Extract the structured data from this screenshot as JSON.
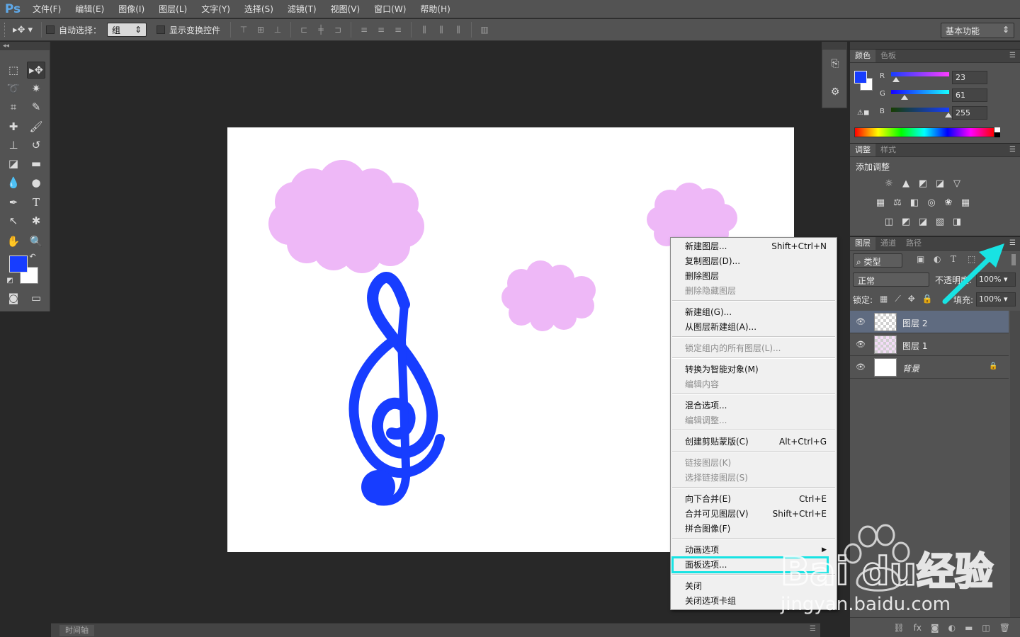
{
  "app": {
    "logo": "Ps"
  },
  "menubar": [
    "文件(F)",
    "编辑(E)",
    "图像(I)",
    "图层(L)",
    "文字(Y)",
    "选择(S)",
    "滤镜(T)",
    "视图(V)",
    "窗口(W)",
    "帮助(H)"
  ],
  "options": {
    "auto_select_label": "自动选择：",
    "auto_select_value": "组",
    "show_transform_label": "显示变换控件",
    "workspace": "基本功能"
  },
  "color_panel": {
    "tabs": [
      "颜色",
      "色板"
    ],
    "r_label": "R",
    "g_label": "G",
    "b_label": "B",
    "r_value": "23",
    "g_value": "61",
    "b_value": "255",
    "foreground_color": "#173dff"
  },
  "adjust_panel": {
    "tabs": [
      "调整",
      "样式"
    ],
    "title": "添加调整"
  },
  "layers_panel": {
    "tabs": [
      "图层",
      "通道",
      "路径"
    ],
    "filter_kind": "类型",
    "blend_mode": "正常",
    "opacity_label": "不透明度:",
    "opacity_value": "100%",
    "lock_label": "锁定:",
    "fill_label": "填充:",
    "fill_value": "100%",
    "layers": [
      {
        "name": "图层 2",
        "selected": true
      },
      {
        "name": "图层 1",
        "selected": false
      },
      {
        "name": "背景",
        "selected": false,
        "locked": true
      }
    ]
  },
  "context_menu": {
    "items": [
      {
        "label": "新建图层...",
        "shortcut": "Shift+Ctrl+N",
        "disabled": false
      },
      {
        "label": "复制图层(D)...",
        "shortcut": "",
        "disabled": false
      },
      {
        "label": "删除图层",
        "shortcut": "",
        "disabled": false
      },
      {
        "label": "删除隐藏图层",
        "shortcut": "",
        "disabled": true
      },
      {
        "label": "新建组(G)...",
        "shortcut": "",
        "disabled": false
      },
      {
        "label": "从图层新建组(A)...",
        "shortcut": "",
        "disabled": false
      },
      {
        "label": "锁定组内的所有图层(L)...",
        "shortcut": "",
        "disabled": true
      },
      {
        "label": "转换为智能对象(M)",
        "shortcut": "",
        "disabled": false
      },
      {
        "label": "编辑内容",
        "shortcut": "",
        "disabled": true
      },
      {
        "label": "混合选项...",
        "shortcut": "",
        "disabled": false
      },
      {
        "label": "编辑调整...",
        "shortcut": "",
        "disabled": true
      },
      {
        "label": "创建剪贴蒙版(C)",
        "shortcut": "Alt+Ctrl+G",
        "disabled": false
      },
      {
        "label": "链接图层(K)",
        "shortcut": "",
        "disabled": true
      },
      {
        "label": "选择链接图层(S)",
        "shortcut": "",
        "disabled": true
      },
      {
        "label": "向下合并(E)",
        "shortcut": "Ctrl+E",
        "disabled": false
      },
      {
        "label": "合并可见图层(V)",
        "shortcut": "Shift+Ctrl+E",
        "disabled": false
      },
      {
        "label": "拼合图像(F)",
        "shortcut": "",
        "disabled": false
      },
      {
        "label": "动画选项",
        "shortcut": "",
        "disabled": false,
        "submenu": true
      },
      {
        "label": "面板选项...",
        "shortcut": "",
        "disabled": false
      },
      {
        "label": "关闭",
        "shortcut": "",
        "disabled": false
      },
      {
        "label": "关闭选项卡组",
        "shortcut": "",
        "disabled": false
      }
    ]
  },
  "timeline": {
    "tab": "时间轴"
  },
  "watermark": {
    "brand": "Baidu经验",
    "url": "jingyan.baidu.com"
  },
  "colors": {
    "highlight": "#18e3e3",
    "cloud": "#eeb8f7",
    "clef": "#173dff"
  }
}
